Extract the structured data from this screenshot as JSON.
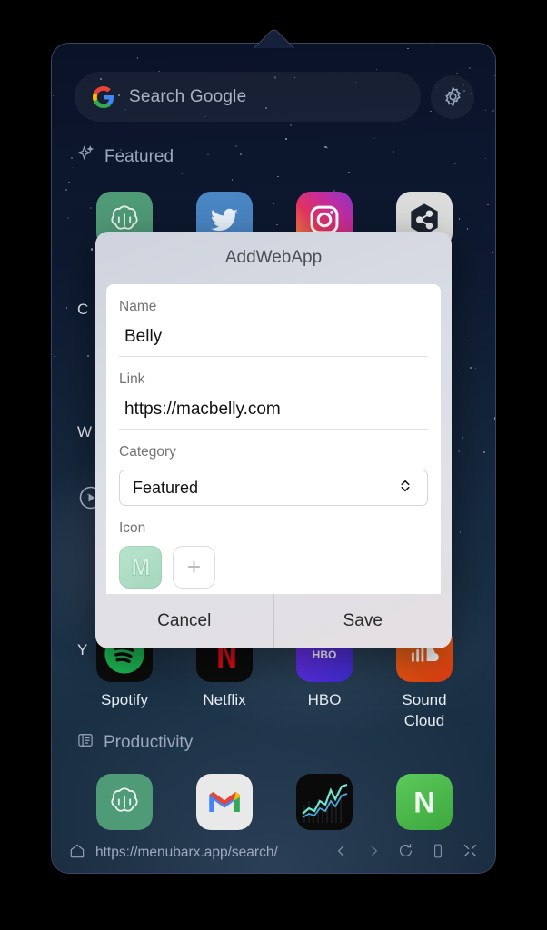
{
  "window": {
    "search": {
      "placeholder": "Search Google",
      "google_icon": "google-g-icon",
      "settings_icon": "gear-icon"
    },
    "sections": [
      {
        "id": "featured",
        "label": "Featured",
        "icon": "sparkle-icon"
      },
      {
        "id": "productivity",
        "label": "Productivity",
        "icon": "panel-icon"
      }
    ],
    "featured_apps": [
      {
        "name": "ChatGPT",
        "icon": "chatgpt-icon",
        "color": "#4f9a77"
      },
      {
        "name": "Twitter",
        "icon": "twitter-icon",
        "color": "#4a86c4"
      },
      {
        "name": "Instagram",
        "icon": "instagram-icon",
        "color": "#c62f8f"
      },
      {
        "name": "Shortcuts",
        "icon": "hexagon-share-icon",
        "color": "#dcdcdc"
      }
    ],
    "media_apps": [
      {
        "name": "Spotify",
        "icon": "spotify-icon",
        "color": "#1db954"
      },
      {
        "name": "Netflix",
        "icon": "netflix-icon",
        "color": "#0b0b0b"
      },
      {
        "name": "HBO",
        "icon": "hbo-icon",
        "color": "#5b2cd6"
      },
      {
        "name": "Sound Cloud",
        "icon": "soundcloud-icon",
        "color": "#d84315"
      }
    ],
    "productivity_apps": [
      {
        "name": "ChatGPT",
        "icon": "chatgpt-icon",
        "color": "#4f9a77"
      },
      {
        "name": "Gmail",
        "icon": "gmail-icon",
        "color": "#e8e8e8"
      },
      {
        "name": "Stocks",
        "icon": "stocks-chart-icon",
        "color": "#101010"
      },
      {
        "name": "Notion",
        "icon": "notion-n-icon",
        "color": "#4caf50"
      }
    ],
    "clipped_labels": [
      "C",
      "W",
      "Y"
    ],
    "bottom_bar": {
      "home_icon": "home-icon",
      "url": "https://menubarx.app/search/",
      "back_icon": "chevron-left-icon",
      "forward_icon": "chevron-right-icon",
      "reload_icon": "reload-icon",
      "device_icon": "mobile-device-icon",
      "close_icon": "collapse-icon"
    }
  },
  "modal": {
    "title": "AddWebApp",
    "fields": {
      "name": {
        "label": "Name",
        "value": "Belly"
      },
      "link": {
        "label": "Link",
        "value": "https://macbelly.com"
      },
      "category": {
        "label": "Category",
        "value": "Featured",
        "stepper_icon": "chevron-updown-icon"
      },
      "icon": {
        "label": "Icon",
        "selected_glyph": "M",
        "selected_color": "#aedcc4",
        "add_label": "+"
      }
    },
    "buttons": {
      "cancel": "Cancel",
      "save": "Save"
    }
  }
}
